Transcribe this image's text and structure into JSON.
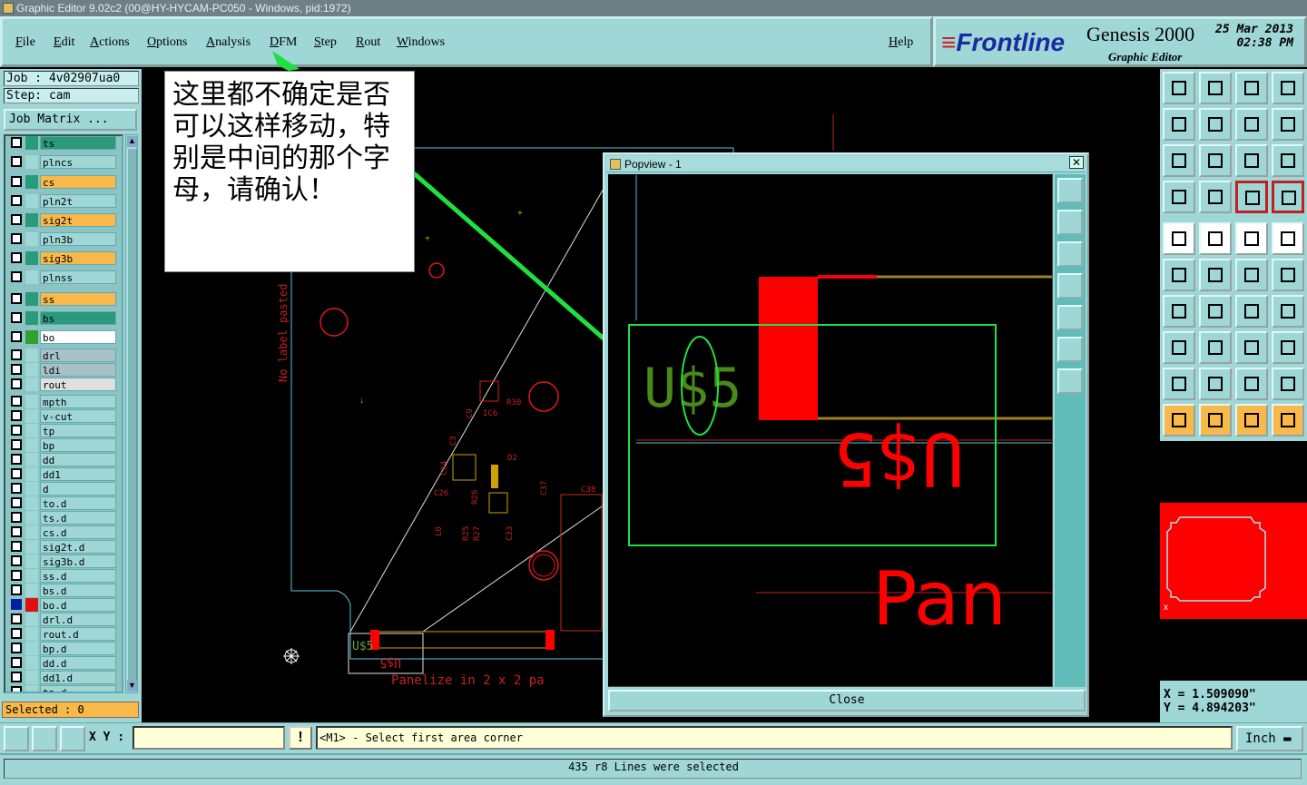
{
  "window_title": "Graphic Editor 9.02c2 (00@HY-HYCAM-PC050 - Windows, pid:1972)",
  "menu": [
    "File",
    "Edit",
    "Actions",
    "Options",
    "Analysis",
    "DFM",
    "Step",
    "Rout",
    "Windows"
  ],
  "help_label": "Help",
  "brand": {
    "logo": "Frontline",
    "product": "Genesis 2000",
    "subtitle": "Graphic Editor",
    "date": "25 Mar 2013",
    "time": "02:38 PM"
  },
  "job": {
    "job_line": "Job : 4v02907ua0",
    "step_line": "Step: cam",
    "matrix_button": "Job Matrix ..."
  },
  "layers": [
    {
      "name": "ts",
      "color": "#2a9a7a",
      "swatch": "#2a9a7a",
      "mark": "✎"
    },
    {
      "name": "plncs",
      "color": "#9fd6d6",
      "swatch": "#9fd6d6",
      "mark": ""
    },
    {
      "name": "cs",
      "color": "#f8b84a",
      "swatch": "#2a9a7a",
      "mark": "✎"
    },
    {
      "name": "pln2t",
      "color": "#9fd6d6",
      "swatch": "#9fd6d6",
      "mark": ""
    },
    {
      "name": "sig2t",
      "color": "#f8b84a",
      "swatch": "#2a9a7a",
      "mark": ""
    },
    {
      "name": "pln3b",
      "color": "#9fd6d6",
      "swatch": "#9fd6d6",
      "mark": ""
    },
    {
      "name": "sig3b",
      "color": "#f8b84a",
      "swatch": "#2a9a7a",
      "mark": ""
    },
    {
      "name": "plnss",
      "color": "#9fd6d6",
      "swatch": "#9fd6d6",
      "mark": ""
    },
    {
      "name": "ss",
      "color": "#f8b84a",
      "swatch": "#2a9a7a",
      "mark": "✎"
    },
    {
      "name": "bs",
      "color": "#2a9a7a",
      "swatch": "#2a9a7a",
      "mark": "✎"
    },
    {
      "name": "bo",
      "color": "#ffffff",
      "swatch": "#30a030",
      "mark": ""
    },
    {
      "name": "drl",
      "color": "#a8c0c8",
      "swatch": "#9fd6d6",
      "mark": ""
    },
    {
      "name": "ldi",
      "color": "#a8c0c8",
      "swatch": "#9fd6d6",
      "mark": ""
    },
    {
      "name": "rout",
      "color": "#e0e0e0",
      "swatch": "#9fd6d6",
      "mark": ""
    },
    {
      "name": "mpth",
      "color": "#9fd6d6",
      "swatch": "#9fd6d6",
      "mark": ""
    },
    {
      "name": "v-cut",
      "color": "#9fd6d6",
      "swatch": "#9fd6d6",
      "mark": ""
    },
    {
      "name": "tp",
      "color": "#9fd6d6",
      "swatch": "#9fd6d6",
      "mark": ""
    },
    {
      "name": "bp",
      "color": "#9fd6d6",
      "swatch": "#9fd6d6",
      "mark": ""
    },
    {
      "name": "dd",
      "color": "#9fd6d6",
      "swatch": "#9fd6d6",
      "mark": ""
    },
    {
      "name": "dd1",
      "color": "#9fd6d6",
      "swatch": "#9fd6d6",
      "mark": ""
    },
    {
      "name": "d",
      "color": "#9fd6d6",
      "swatch": "#9fd6d6",
      "mark": ""
    },
    {
      "name": "to.d",
      "color": "#9fd6d6",
      "swatch": "#9fd6d6",
      "mark": ""
    },
    {
      "name": "ts.d",
      "color": "#9fd6d6",
      "swatch": "#9fd6d6",
      "mark": "✎"
    },
    {
      "name": "cs.d",
      "color": "#9fd6d6",
      "swatch": "#9fd6d6",
      "mark": "✎"
    },
    {
      "name": "sig2t.d",
      "color": "#9fd6d6",
      "swatch": "#9fd6d6",
      "mark": ""
    },
    {
      "name": "sig3b.d",
      "color": "#9fd6d6",
      "swatch": "#9fd6d6",
      "mark": ""
    },
    {
      "name": "ss.d",
      "color": "#9fd6d6",
      "swatch": "#9fd6d6",
      "mark": "✎"
    },
    {
      "name": "bs.d",
      "color": "#9fd6d6",
      "swatch": "#9fd6d6",
      "mark": "✎"
    },
    {
      "name": "bo.d",
      "color": "#9fd6d6",
      "swatch": "#e01010",
      "mark": "⊞",
      "selected": true
    },
    {
      "name": "drl.d",
      "color": "#9fd6d6",
      "swatch": "#9fd6d6",
      "mark": ""
    },
    {
      "name": "rout.d",
      "color": "#9fd6d6",
      "swatch": "#9fd6d6",
      "mark": ""
    },
    {
      "name": "bp.d",
      "color": "#9fd6d6",
      "swatch": "#9fd6d6",
      "mark": ""
    },
    {
      "name": "dd.d",
      "color": "#9fd6d6",
      "swatch": "#9fd6d6",
      "mark": ""
    },
    {
      "name": "dd1.d",
      "color": "#9fd6d6",
      "swatch": "#9fd6d6",
      "mark": ""
    },
    {
      "name": "tp.d",
      "color": "#9fd6d6",
      "swatch": "#9fd6d6",
      "mark": ""
    }
  ],
  "selected_label": "Selected : 0",
  "annotation_note": "这里都不确定是否可以这样移动，特别是中间的那个字母，请确认！",
  "canvas_texts": {
    "c9": "C9",
    "c3": "C3",
    "r30": "R30",
    "ic6": "IC6",
    "d2": "D2",
    "c37": "C37",
    "c38": "C38",
    "c26": "C26",
    "c34": "C34",
    "r26": "R26",
    "r25": "R25",
    "r27": "R27",
    "l0": "L0",
    "c33": "C33",
    "panelize": "Panelize in 2 x 2 pa",
    "no_label": "No label pasted",
    "marker": "U$5"
  },
  "popview": {
    "title": "Popview - 1",
    "close_label": "Close",
    "green_text": "U$5",
    "red_text": "U$5",
    "pan_text": "Pan"
  },
  "coords": {
    "x_line": "X = 1.509090\"",
    "y_line": "Y = 4.894203\""
  },
  "xy_label": "X Y :",
  "xy_value": "",
  "message": "<M1> - Select first area corner",
  "units": "Inch",
  "status": "435 r8 Lines were selected",
  "colors": {
    "panel": "#9fd6d6",
    "accent_orange": "#f8b84a",
    "accent_green": "#2a9a7a",
    "highlight_green": "#20e040",
    "pcb_red": "#ff0000"
  }
}
